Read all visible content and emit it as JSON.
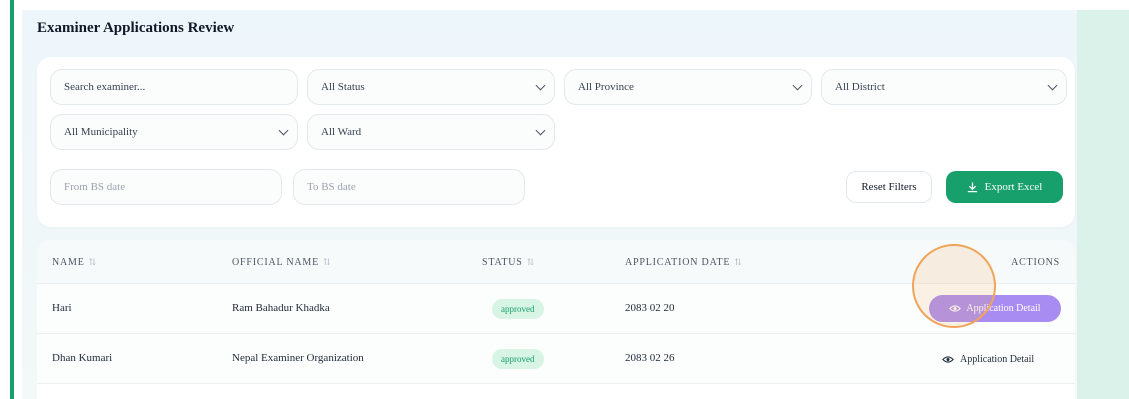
{
  "page": {
    "title": "Examiner Applications Review"
  },
  "filters": {
    "search_placeholder": "Search examiner...",
    "status": "All Status",
    "province": "All Province",
    "district": "All District",
    "municipality": "All Municipality",
    "ward": "All Ward",
    "from_date_placeholder": "From BS date",
    "to_date_placeholder": "To BS date",
    "reset_label": "Reset Filters",
    "export_label": "Export Excel"
  },
  "table": {
    "columns": [
      "NAME",
      "OFFICIAL NAME",
      "STATUS",
      "APPLICATION DATE",
      "ACTIONS"
    ],
    "rows": [
      {
        "name": "Hari",
        "official_name": "Ram Bahadur Khadka",
        "status": "approved",
        "date": "2083 02 20",
        "action": "Application Detail"
      },
      {
        "name": "Dhan Kumari",
        "official_name": "Nepal Examiner Organization",
        "status": "approved",
        "date": "2083 02 26",
        "action": "Application Detail"
      }
    ]
  },
  "colors": {
    "accent_green": "#17a06b",
    "action_purple": "#a98cf2",
    "cursor_highlight": "#f0a45a"
  },
  "icons": {
    "sort": "sort-icon",
    "chevron": "chevron-down-icon",
    "download": "download-icon",
    "eye": "eye-icon"
  }
}
